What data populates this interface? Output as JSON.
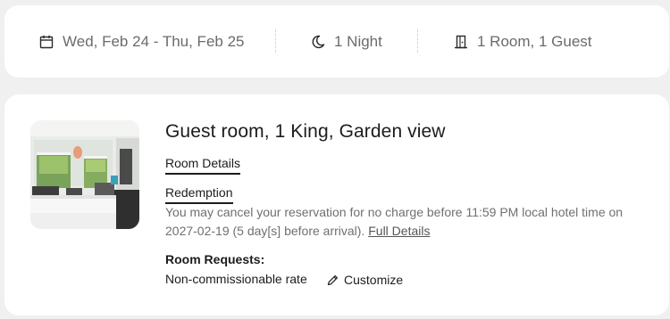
{
  "summary": {
    "dates": "Wed, Feb 24 - Thu, Feb 25",
    "nights": "1 Night",
    "rooms_guests": "1 Room, 1 Guest",
    "icons": [
      "calendar-icon",
      "moon-icon",
      "door-icon"
    ]
  },
  "room": {
    "title": "Guest room, 1 King, Garden view",
    "details_link": "Room Details",
    "redemption_link": "Redemption",
    "policy_text": "You may cancel your reservation for no charge before 11:59 PM local hotel time on 2027-02-19 (5 day[s] before arrival).",
    "full_details_link": "Full Details",
    "requests_label": "Room Requests:",
    "rate_text": "Non-commissionable rate",
    "customize_label": "Customize"
  }
}
